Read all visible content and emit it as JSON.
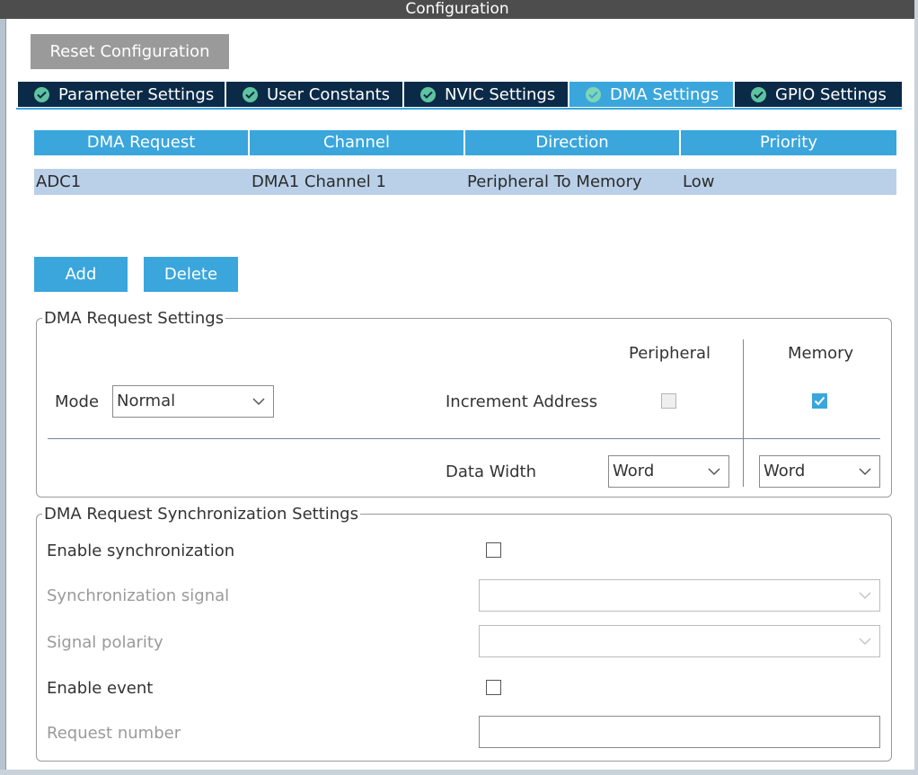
{
  "window": {
    "title": "Configuration"
  },
  "toolbar": {
    "reset_label": "Reset Configuration"
  },
  "tabs": [
    {
      "label": "Parameter Settings",
      "active": false,
      "icon": "check-circle-icon"
    },
    {
      "label": "User Constants",
      "active": false,
      "icon": "check-circle-icon"
    },
    {
      "label": "NVIC Settings",
      "active": false,
      "icon": "check-circle-icon"
    },
    {
      "label": "DMA Settings",
      "active": true,
      "icon": "check-circle-icon"
    },
    {
      "label": "GPIO Settings",
      "active": false,
      "icon": "check-circle-icon"
    }
  ],
  "table": {
    "columns": [
      "DMA Request",
      "Channel",
      "Direction",
      "Priority"
    ],
    "rows": [
      [
        "ADC1",
        "DMA1 Channel 1",
        "Peripheral To Memory",
        "Low"
      ]
    ]
  },
  "actions": {
    "add_label": "Add",
    "delete_label": "Delete"
  },
  "dma_request_settings": {
    "legend": "DMA Request Settings",
    "peripheral_header": "Peripheral",
    "memory_header": "Memory",
    "mode_label": "Mode",
    "mode_value": "Normal",
    "increment_address_label": "Increment Address",
    "peripheral_increment": false,
    "memory_increment": true,
    "data_width_label": "Data Width",
    "peripheral_data_width": "Word",
    "memory_data_width": "Word"
  },
  "sync_settings": {
    "legend": "DMA Request Synchronization Settings",
    "enable_sync_label": "Enable synchronization",
    "enable_sync": false,
    "sync_signal_label": "Synchronization signal",
    "sync_signal_value": "",
    "signal_polarity_label": "Signal polarity",
    "signal_polarity_value": "",
    "enable_event_label": "Enable event",
    "enable_event": false,
    "request_number_label": "Request number",
    "request_number_value": ""
  },
  "colors": {
    "accent": "#3aa6dc",
    "tab_bg": "#0b2a48",
    "title_bar": "#4d4d4d",
    "row_selected": "#b9d0e8",
    "reset_button": "#9a9a9a"
  }
}
